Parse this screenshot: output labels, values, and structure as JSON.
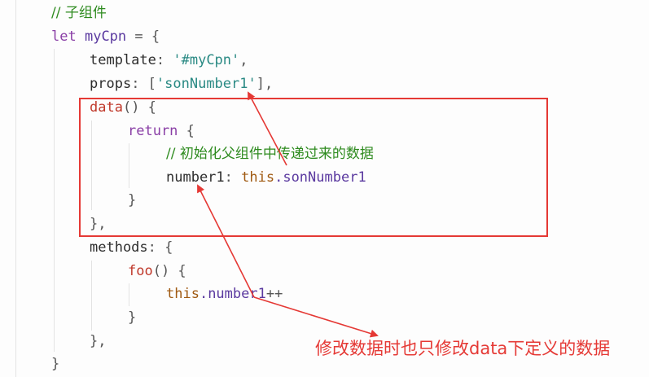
{
  "code": {
    "comment_child": "// 子组件",
    "let_kw": "let",
    "var_name": "myCpn",
    "eq_open": " = {",
    "template_key": "template",
    "template_value": "'#myCpn'",
    "props_key": "props",
    "props_value": "'sonNumber1'",
    "data_fn": "data",
    "return_kw": "return",
    "comment_init": "// 初始化父组件中传递过来的数据",
    "number1_key": "number1",
    "this_kw": "this",
    "son_number": ".sonNumber1",
    "methods_key": "methods",
    "foo_fn": "foo",
    "this_kw2": "this",
    "number_incr": ".number1",
    "incr_op": "++"
  },
  "annotation": {
    "text": "修改数据时也只修改data下定义的数据",
    "color": "#e53935"
  },
  "colors": {
    "comment": "#2e8b1f",
    "keyword": "#8a3fa6",
    "string": "#2a8a84",
    "function": "#c0392b",
    "this": "#a05a12",
    "highlight_border": "#e53935"
  }
}
